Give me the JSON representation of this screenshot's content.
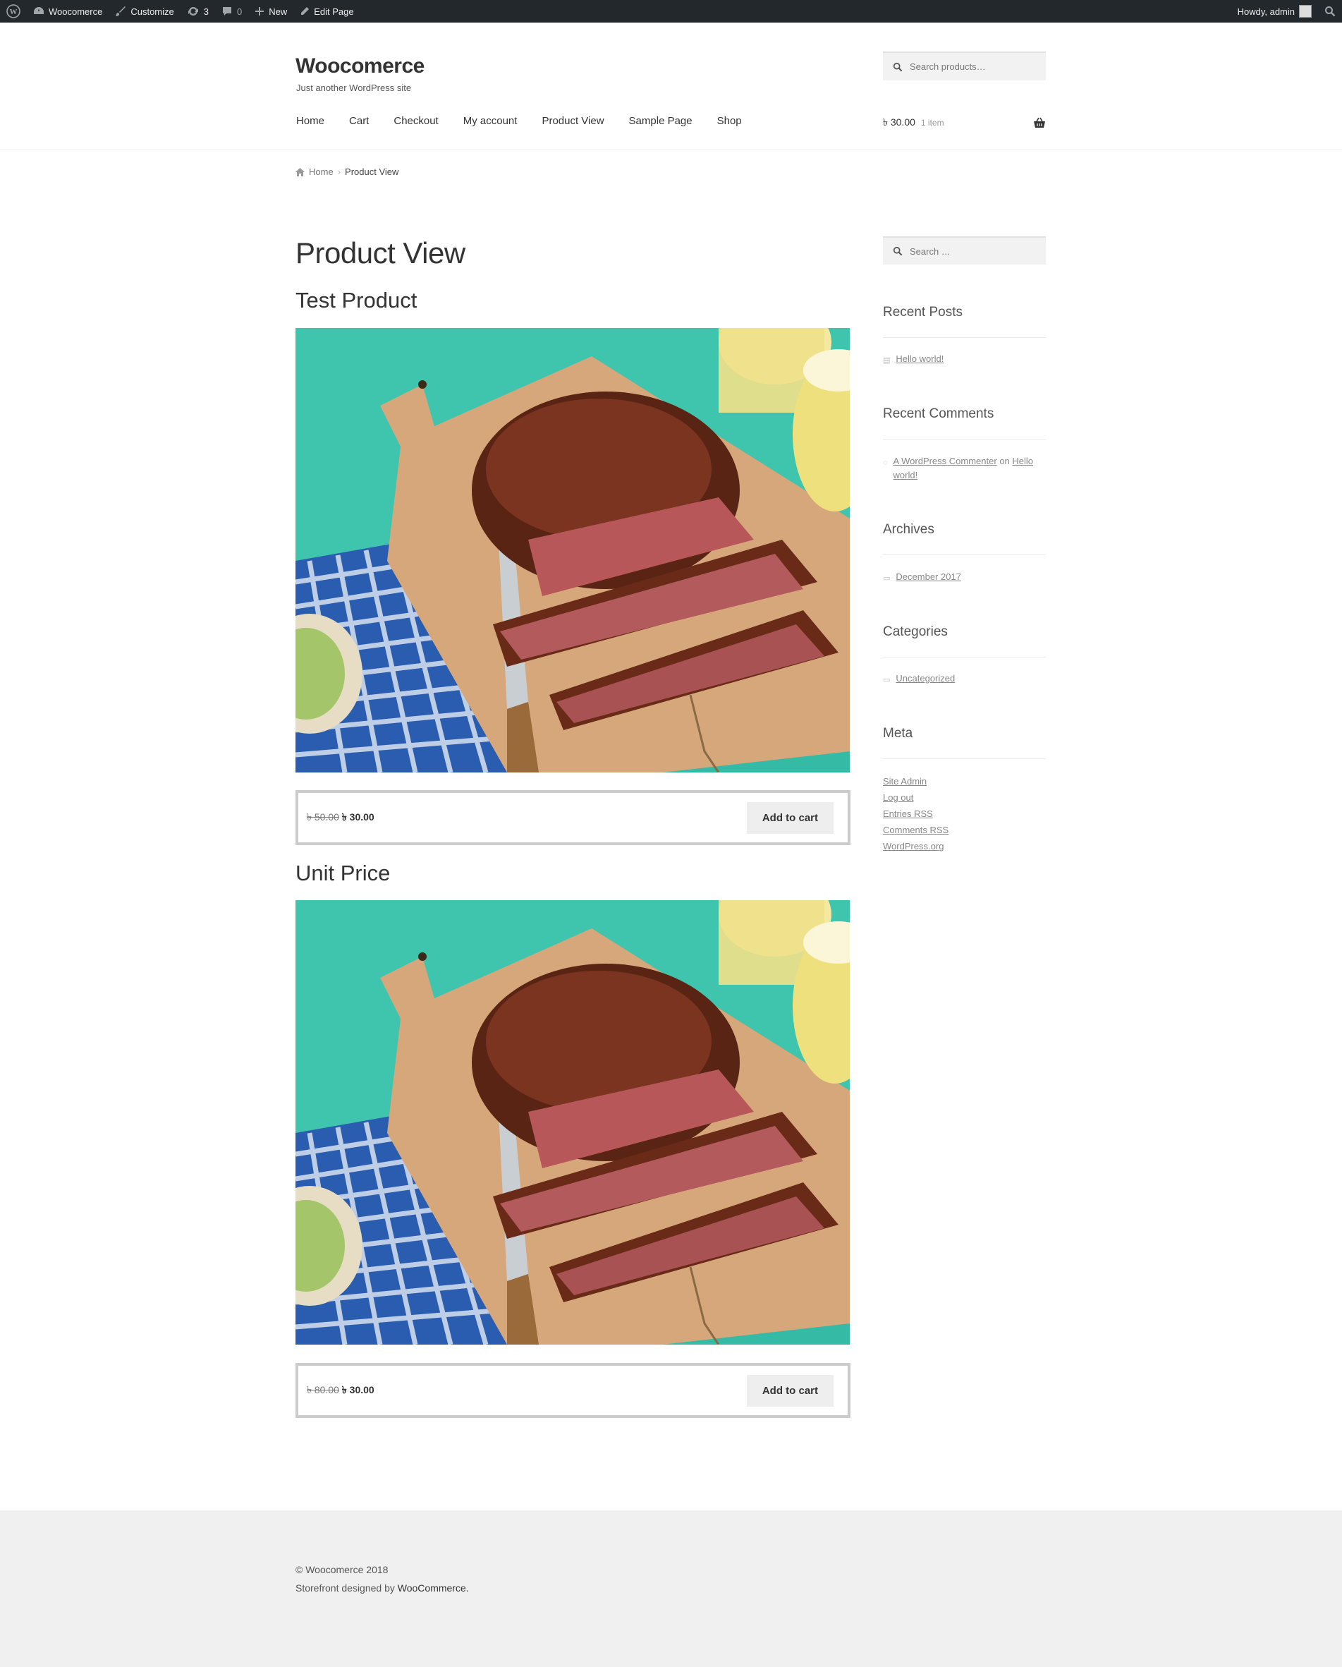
{
  "adminbar": {
    "site": "Woocomerce",
    "customize": "Customize",
    "updates": "3",
    "comments": "0",
    "new": "New",
    "edit": "Edit Page",
    "howdy": "Howdy, admin"
  },
  "header": {
    "title": "Woocomerce",
    "tagline": "Just another WordPress site",
    "search_placeholder": "Search products…",
    "nav": [
      "Home",
      "Cart",
      "Checkout",
      "My account",
      "Product View",
      "Sample Page",
      "Shop"
    ],
    "cart_amount": "৳ 30.00",
    "cart_count": "1 item"
  },
  "breadcrumb": {
    "home": "Home",
    "current": "Product View"
  },
  "main": {
    "page_title": "Product View",
    "products": [
      {
        "title": "Test Product",
        "old_price": "৳ 50.00",
        "price": "৳ 30.00",
        "button": "Add to cart"
      },
      {
        "title": "Unit Price",
        "old_price": "৳ 80.00",
        "price": "৳ 30.00",
        "button": "Add to cart"
      }
    ]
  },
  "sidebar": {
    "search_placeholder": "Search …",
    "recent_posts": {
      "title": "Recent Posts",
      "items": [
        "Hello world!"
      ]
    },
    "recent_comments": {
      "title": "Recent Comments",
      "author": "A WordPress Commenter",
      "on": "on",
      "post": "Hello world!"
    },
    "archives": {
      "title": "Archives",
      "items": [
        "December 2017"
      ]
    },
    "categories": {
      "title": "Categories",
      "items": [
        "Uncategorized"
      ]
    },
    "meta": {
      "title": "Meta",
      "items": [
        "Site Admin",
        "Log out",
        "Entries RSS",
        "Comments RSS",
        "WordPress.org"
      ]
    }
  },
  "footer": {
    "copyright": "© Woocomerce 2018",
    "designed_by": "Storefront designed by",
    "designer": "WooCommerce."
  },
  "colors": {
    "adminbar": "#23282d",
    "footer": "#f0f0f0",
    "teal": "#2fbfa8"
  }
}
